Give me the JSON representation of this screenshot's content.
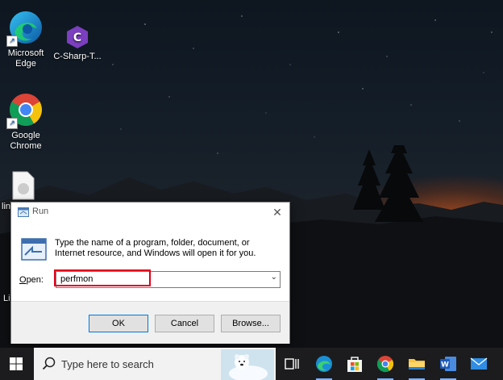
{
  "desktop": {
    "icons": [
      {
        "label": "Microsoft Edge"
      },
      {
        "label": "C-Sharp-T..."
      },
      {
        "label": "Google Chrome"
      },
      {
        "label": "lin"
      },
      {
        "label": "Li"
      }
    ]
  },
  "run_dialog": {
    "title": "Run",
    "description": "Type the name of a program, folder, document, or Internet resource, and Windows will open it for you.",
    "open_label_prefix": "O",
    "open_label_rest": "pen:",
    "open_value": "perfmon",
    "buttons": {
      "ok": "OK",
      "cancel": "Cancel",
      "browse": "Browse..."
    },
    "highlight_color": "#e0001b"
  },
  "taskbar": {
    "search_placeholder": "Type here to search",
    "pinned": [
      "task-view-icon",
      "edge-icon",
      "store-icon",
      "chrome-icon",
      "file-explorer-icon",
      "word-icon",
      "mail-icon"
    ]
  }
}
